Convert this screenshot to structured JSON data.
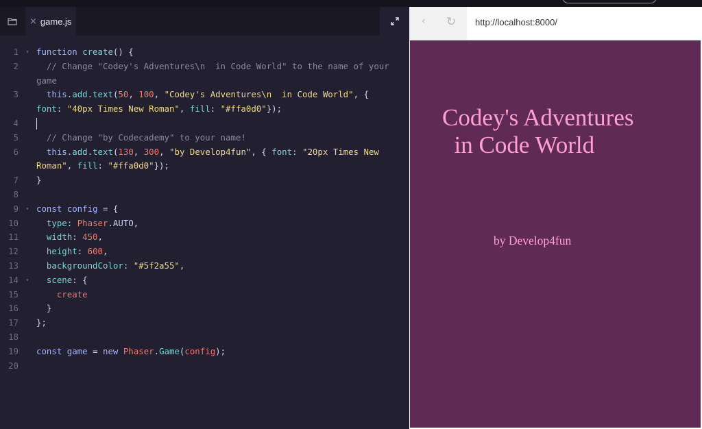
{
  "editor": {
    "tab": {
      "close_glyph": "×",
      "filename": "game.js"
    },
    "icons": {
      "folder": "folder-icon",
      "expand": "expand-icon"
    },
    "lines": [
      {
        "n": "1",
        "fold": "▾",
        "parts": [
          [
            "kw",
            "function "
          ],
          [
            "fn",
            "create"
          ],
          [
            "pu",
            "() {"
          ]
        ]
      },
      {
        "n": "2",
        "fold": "",
        "parts": [
          [
            "cm",
            "  // Change \"Codey's Adventures\\n  in Code World\" to the name of your"
          ]
        ]
      },
      {
        "n": "",
        "fold": "",
        "parts": [
          [
            "cm",
            "game"
          ]
        ]
      },
      {
        "n": "3",
        "fold": "",
        "parts": [
          [
            "kw",
            "  this"
          ],
          [
            "pu",
            "."
          ],
          [
            "fn",
            "add"
          ],
          [
            "pu",
            "."
          ],
          [
            "fn",
            "text"
          ],
          [
            "pu",
            "("
          ],
          [
            "nm",
            "50"
          ],
          [
            "pu",
            ", "
          ],
          [
            "nm",
            "100"
          ],
          [
            "pu",
            ", "
          ],
          [
            "st",
            "\"Codey's Adventures\\n  in Code World\""
          ],
          [
            "pu",
            ", {"
          ]
        ]
      },
      {
        "n": "",
        "fold": "",
        "parts": [
          [
            "pr",
            "font"
          ],
          [
            "pu",
            ": "
          ],
          [
            "st",
            "\"40px Times New Roman\""
          ],
          [
            "pu",
            ", "
          ],
          [
            "pr",
            "fill"
          ],
          [
            "pu",
            ": "
          ],
          [
            "st",
            "\"#ffa0d0\""
          ],
          [
            "pu",
            "});"
          ]
        ]
      },
      {
        "n": "4",
        "fold": "",
        "parts": [
          [
            "cursor",
            ""
          ]
        ]
      },
      {
        "n": "5",
        "fold": "",
        "parts": [
          [
            "cm",
            "  // Change \"by Codecademy\" to your name!"
          ]
        ]
      },
      {
        "n": "6",
        "fold": "",
        "parts": [
          [
            "kw",
            "  this"
          ],
          [
            "pu",
            "."
          ],
          [
            "fn",
            "add"
          ],
          [
            "pu",
            "."
          ],
          [
            "fn",
            "text"
          ],
          [
            "pu",
            "("
          ],
          [
            "nm",
            "130"
          ],
          [
            "pu",
            ", "
          ],
          [
            "nm",
            "300"
          ],
          [
            "pu",
            ", "
          ],
          [
            "st",
            "\"by Develop4fun\""
          ],
          [
            "pu",
            ", { "
          ],
          [
            "pr",
            "font"
          ],
          [
            "pu",
            ": "
          ],
          [
            "st",
            "\"20px Times New"
          ]
        ]
      },
      {
        "n": "",
        "fold": "",
        "parts": [
          [
            "st",
            "Roman\""
          ],
          [
            "pu",
            ", "
          ],
          [
            "pr",
            "fill"
          ],
          [
            "pu",
            ": "
          ],
          [
            "st",
            "\"#ffa0d0\""
          ],
          [
            "pu",
            "});"
          ]
        ]
      },
      {
        "n": "7",
        "fold": "",
        "parts": [
          [
            "pu",
            "}"
          ]
        ]
      },
      {
        "n": "8",
        "fold": "",
        "parts": []
      },
      {
        "n": "9",
        "fold": "▾",
        "parts": [
          [
            "kw",
            "const "
          ],
          [
            "kw",
            "config"
          ],
          [
            "pu",
            " = {"
          ]
        ]
      },
      {
        "n": "10",
        "fold": "",
        "parts": [
          [
            "pr",
            "  type"
          ],
          [
            "pu",
            ": "
          ],
          [
            "cl",
            "Phaser"
          ],
          [
            "pu",
            ".AUTO,"
          ]
        ]
      },
      {
        "n": "11",
        "fold": "",
        "parts": [
          [
            "pr",
            "  width"
          ],
          [
            "pu",
            ": "
          ],
          [
            "nm",
            "450"
          ],
          [
            "pu",
            ","
          ]
        ]
      },
      {
        "n": "12",
        "fold": "",
        "parts": [
          [
            "pr",
            "  height"
          ],
          [
            "pu",
            ": "
          ],
          [
            "nm",
            "600"
          ],
          [
            "pu",
            ","
          ]
        ]
      },
      {
        "n": "13",
        "fold": "",
        "parts": [
          [
            "pr",
            "  backgroundColor"
          ],
          [
            "pu",
            ": "
          ],
          [
            "st",
            "\"#5f2a55\""
          ],
          [
            "pu",
            ","
          ]
        ]
      },
      {
        "n": "14",
        "fold": "▾",
        "parts": [
          [
            "pr",
            "  scene"
          ],
          [
            "pu",
            ": {"
          ]
        ]
      },
      {
        "n": "15",
        "fold": "",
        "parts": [
          [
            "cl",
            "    create"
          ]
        ]
      },
      {
        "n": "16",
        "fold": "",
        "parts": [
          [
            "pu",
            "  }"
          ]
        ]
      },
      {
        "n": "17",
        "fold": "",
        "parts": [
          [
            "pu",
            "};"
          ]
        ]
      },
      {
        "n": "18",
        "fold": "",
        "parts": []
      },
      {
        "n": "19",
        "fold": "",
        "parts": [
          [
            "kw",
            "const "
          ],
          [
            "kw",
            "game"
          ],
          [
            "pu",
            " = "
          ],
          [
            "kw",
            "new "
          ],
          [
            "cl",
            "Phaser"
          ],
          [
            "pu",
            "."
          ],
          [
            "fn",
            "Game"
          ],
          [
            "pu",
            "("
          ],
          [
            "cl",
            "config"
          ],
          [
            "pu",
            ");"
          ]
        ]
      },
      {
        "n": "20",
        "fold": "",
        "parts": []
      }
    ]
  },
  "browser": {
    "back_glyph": "‹",
    "reload_glyph": "↻",
    "url": "http://localhost:8000/",
    "game": {
      "background": "#5f2a55",
      "text_color": "#ffa0d0",
      "title": "Codey's Adventures\n  in Code World",
      "byline": "by Develop4fun"
    }
  }
}
